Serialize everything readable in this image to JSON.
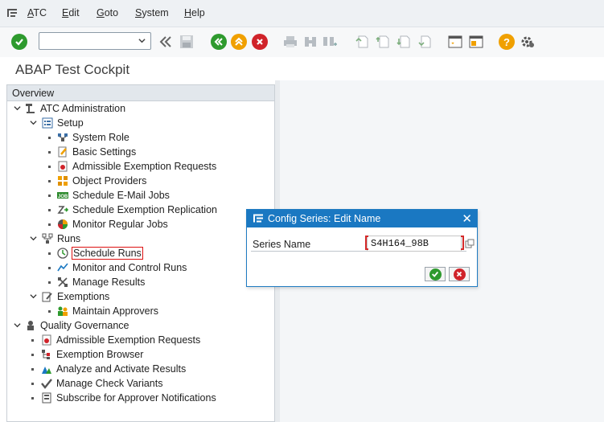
{
  "menu": {
    "items": [
      "ATC",
      "Edit",
      "Goto",
      "System",
      "Help"
    ],
    "underline": [
      "A",
      "E",
      "G",
      "S",
      "H"
    ],
    "rest": [
      "TC",
      "dit",
      "oto",
      "ystem",
      "elp"
    ]
  },
  "toolbar": {
    "command_field_value": ""
  },
  "page": {
    "title": "ABAP Test Cockpit"
  },
  "tree": {
    "header": "Overview",
    "atc_admin": "ATC Administration",
    "setup": "Setup",
    "system_role": "System Role",
    "basic_settings": "Basic Settings",
    "admissible_exemption_requests": "Admissible Exemption Requests",
    "object_providers": "Object Providers",
    "schedule_email_jobs": "Schedule E-Mail Jobs",
    "schedule_exemption_replication": "Schedule Exemption Replication",
    "monitor_regular_jobs": "Monitor Regular Jobs",
    "runs": "Runs",
    "schedule_runs": "Schedule Runs",
    "monitor_control_runs": "Monitor and Control Runs",
    "manage_results": "Manage Results",
    "exemptions": "Exemptions",
    "maintain_approvers": "Maintain Approvers",
    "quality_governance": "Quality Governance",
    "qg_admissible_exemption_requests": "Admissible Exemption Requests",
    "exemption_browser": "Exemption Browser",
    "analyze_activate_results": "Analyze and Activate Results",
    "manage_check_variants": "Manage Check Variants",
    "subscribe_approver_notifications": "Subscribe for Approver Notifications"
  },
  "dialog": {
    "title": "Config Series: Edit Name",
    "field_label": "Series Name",
    "field_value": "S4H164_98B"
  },
  "colors": {
    "dialog_header": "#1a78c2",
    "ok_green": "#2e9a2e",
    "cancel_red": "#d0232a",
    "nav_orange": "#f0a000"
  }
}
